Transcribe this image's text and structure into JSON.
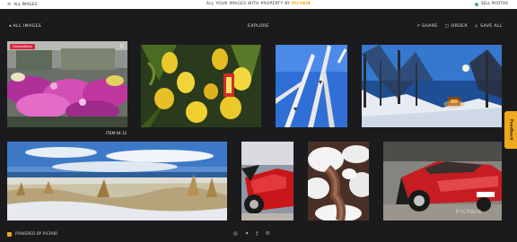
{
  "topbar": {
    "left_text": "ALL IMAGES",
    "center_text": "ALL YOUR IMAGES WITH PROPERTY BY",
    "brand_text": "PICFAIR",
    "right_text": "SELL PHOTOS",
    "accent": "#f0a81c",
    "status_color": "#3cb371"
  },
  "toolbar": {
    "back_label": "ALL IMAGES",
    "title": "EXPLORE",
    "share_label": "SHARE",
    "order_label": "ORDER",
    "save_label": "SAVE ALL"
  },
  "tiles": {
    "badge_label": "Competition",
    "caption_1": "ITEM 04.12",
    "watermark": "PICFAIR"
  },
  "feedback": {
    "label": "Feedback"
  },
  "footer": {
    "powered": "POWERED BY PICFAIR",
    "social_icons": [
      "instagram-icon",
      "twitter-icon",
      "facebook-icon",
      "pinterest-icon"
    ]
  }
}
